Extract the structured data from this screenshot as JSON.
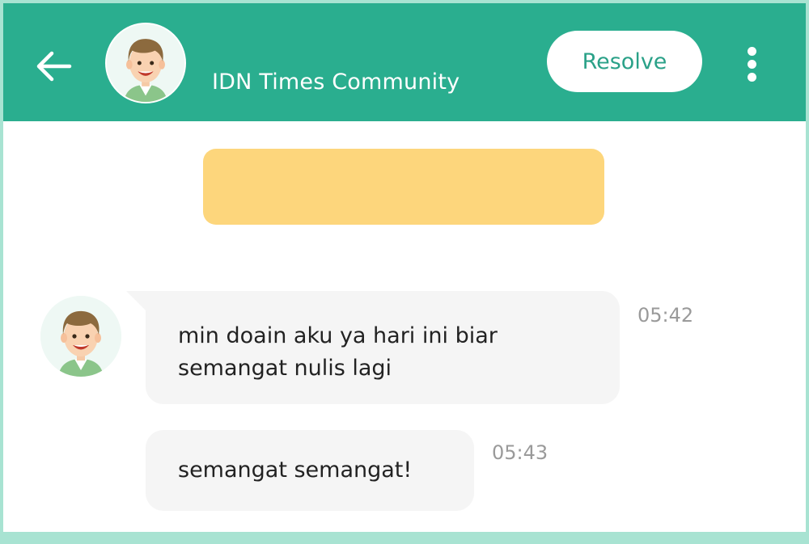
{
  "header": {
    "title": "IDN Times Community",
    "resolve_label": "Resolve",
    "back_icon": "arrow-left-icon",
    "menu_icon": "more-vertical-icon",
    "color": "#2aae8f"
  },
  "notice": {
    "color": "#fdd67c"
  },
  "messages": [
    {
      "text": "min doain aku ya hari ini biar semangat nulis lagi",
      "time": "05:42"
    },
    {
      "text": "semangat semangat!",
      "time": "05:43"
    }
  ]
}
